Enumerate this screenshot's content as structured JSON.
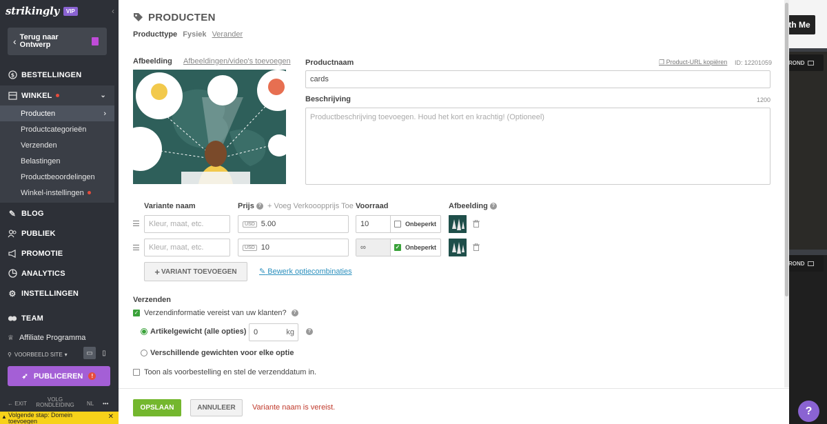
{
  "sidebar": {
    "logo": "strikingly",
    "vip_badge": "VIP",
    "back_button": {
      "line1": "Terug naar",
      "line2": "Ontwerp"
    },
    "nav": {
      "orders": "BESTELLINGEN",
      "shop": "WINKEL",
      "blog": "BLOG",
      "audience": "PUBLIEK",
      "promotion": "PROMOTIE",
      "analytics": "ANALYTICS",
      "settings": "INSTELLINGEN",
      "team": "TEAM",
      "affiliate": "Affiliate Programma"
    },
    "shop_sub": {
      "products": "Producten",
      "categories": "Productcategorieën",
      "shipping": "Verzenden",
      "taxes": "Belastingen",
      "reviews": "Productbeoordelingen",
      "shop_settings": "Winkel-instellingen"
    },
    "preview_site": "VOORBEELD SITE",
    "publish": "PUBLICEREN",
    "bottom": {
      "exit": "EXIT",
      "guide_line1": "VOLG",
      "guide_line2": "RONDLEIDING",
      "lang": "NL",
      "more": "•••"
    },
    "next_step": {
      "line1": "Volgende stap: Domein",
      "line2": "toevoegen"
    }
  },
  "product": {
    "header": "PRODUCTEN",
    "product_type_label": "Producttype",
    "product_type_value": "Fysiek",
    "change_link": "Verander",
    "image_label": "Afbeelding",
    "add_media_link": "Afbeeldingen/video's toevoegen",
    "name_label": "Productnaam",
    "copy_url_link": "Product-URL kopiëren",
    "id_text": "ID: 12201059",
    "name_value": "cards",
    "description_label": "Beschrijving",
    "description_count": "1200",
    "description_placeholder": "Productbeschrijving toevoegen. Houd het kort en krachtig! (Optioneel)"
  },
  "variants": {
    "headers": {
      "name": "Variante naam",
      "price": "Prijs",
      "compare_price": "+ Voeg Verkooopprijs Toe",
      "stock": "Voorraad",
      "image": "Afbeelding"
    },
    "name_placeholder": "Kleur, maat, etc.",
    "currency": "USD",
    "unlimited_label": "Onbeperkt",
    "rows": [
      {
        "price": "5.00",
        "stock": "10",
        "unlimited": false
      },
      {
        "price": "10",
        "stock": "∞",
        "unlimited": true
      }
    ],
    "add_variant": "VARIANT TOEVOEGEN",
    "edit_combinations": "Bewerk optiecombinaties"
  },
  "shipping": {
    "title": "Verzenden",
    "requires_info": "Verzendinformatie vereist van uw klanten?",
    "weight_option": "Artikelgewicht (alle opties)",
    "weight_value": "0",
    "weight_unit": "kg",
    "different_weights": "Verschillende gewichten voor elke optie",
    "preorder": "Toon als voorbestelling en stel de verzenddatum in."
  },
  "footer": {
    "save": "OPSLAAN",
    "cancel": "ANNULEER",
    "error": "Variante naam is vereist."
  },
  "preview": {
    "button_text": "th Me",
    "rond_label": "ROND"
  },
  "colors": {
    "accent_purple": "#a45fd6",
    "save_green": "#74b72e",
    "error_red": "#c0392b",
    "link_blue": "#2a8fbd"
  }
}
